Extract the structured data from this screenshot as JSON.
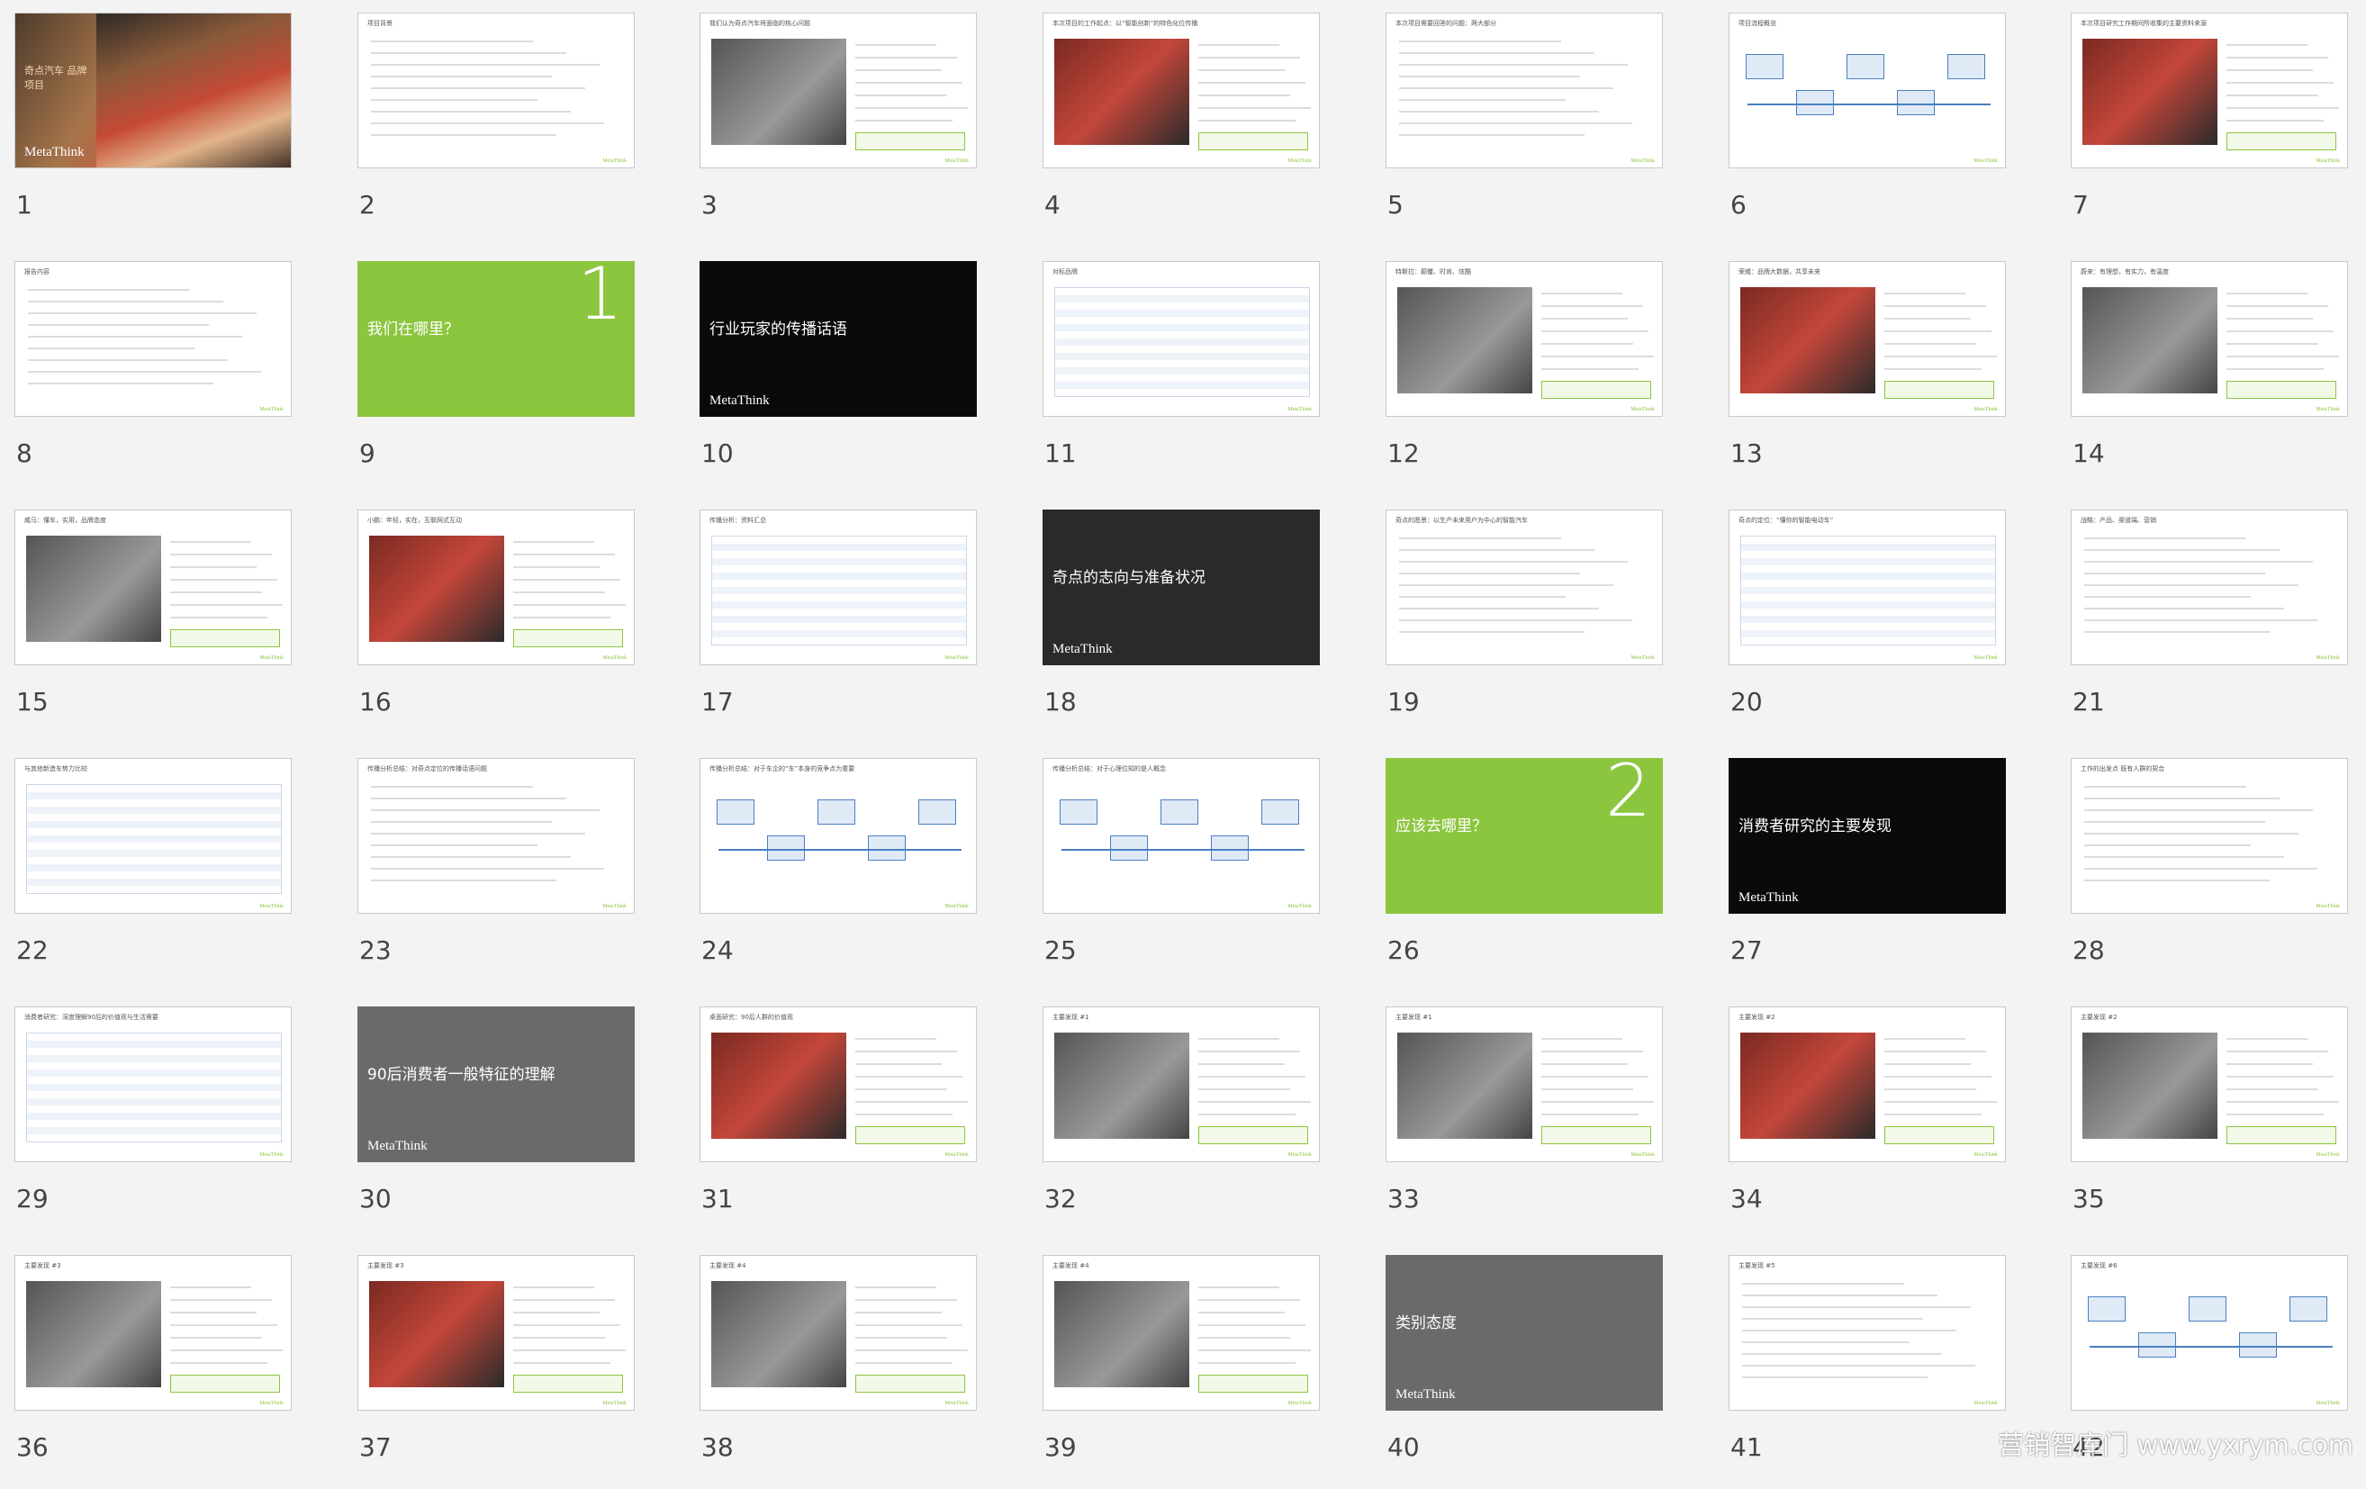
{
  "slides": [
    {
      "n": "1",
      "kind": "photo",
      "label": "",
      "logo": "MetaThink",
      "caption": "奇点汽车 品牌项目"
    },
    {
      "n": "2",
      "kind": "text",
      "title": "项目背景"
    },
    {
      "n": "3",
      "kind": "mixed",
      "title": "我们认为奇点汽车将面临的核心问题"
    },
    {
      "n": "4",
      "kind": "mixed",
      "title": "本次项目的工作起点：以“智能创新”的特色化位传播"
    },
    {
      "n": "5",
      "kind": "text",
      "title": "本次项目需要回答的问题：两大部分"
    },
    {
      "n": "6",
      "kind": "diagram",
      "title": "项目流程概览"
    },
    {
      "n": "7",
      "kind": "mixed",
      "title": "本次项目研究工作期间所收集的主要资料来源"
    },
    {
      "n": "8",
      "kind": "text",
      "title": "报告内容"
    },
    {
      "n": "9",
      "kind": "green",
      "label": "我们在哪里？",
      "big": "1"
    },
    {
      "n": "10",
      "kind": "black",
      "label": "行业玩家的传播话语",
      "logo": "MetaThink"
    },
    {
      "n": "11",
      "kind": "table",
      "title": "对标品牌"
    },
    {
      "n": "12",
      "kind": "mixed",
      "title": "特斯拉：颠覆、时尚、炫酷"
    },
    {
      "n": "13",
      "kind": "mixed",
      "title": "荣威：品牌大数据，共享未来"
    },
    {
      "n": "14",
      "kind": "mixed",
      "title": "蔚来：有理想，有实力，有温度"
    },
    {
      "n": "15",
      "kind": "mixed",
      "title": "威马：懂车，实用，品牌态度"
    },
    {
      "n": "16",
      "kind": "mixed",
      "title": "小鹏：年轻，实在，互联网式互动"
    },
    {
      "n": "17",
      "kind": "table",
      "title": "传播分析：资料汇总"
    },
    {
      "n": "18",
      "kind": "dark",
      "label": "奇点的志向与准备状况",
      "logo": "MetaThink"
    },
    {
      "n": "19",
      "kind": "text",
      "title": "奇点的愿景：以生产未来用户为中心的智能汽车"
    },
    {
      "n": "20",
      "kind": "table",
      "title": "奇点的定位：“懂你的智能电动车”"
    },
    {
      "n": "21",
      "kind": "text",
      "title": "战略：产品、渠道端、营销"
    },
    {
      "n": "22",
      "kind": "table",
      "title": "与其他新造车势力比较"
    },
    {
      "n": "23",
      "kind": "text",
      "title": "传播分析总结：对奇点定位的传播话语问题"
    },
    {
      "n": "24",
      "kind": "diagram",
      "title": "传播分析总结：对于车企的“车”本身的竞争点为重要"
    },
    {
      "n": "25",
      "kind": "diagram",
      "title": "传播分析总结：对于心理位知的是人概念"
    },
    {
      "n": "26",
      "kind": "green",
      "label": "应该去哪里？",
      "big": "2"
    },
    {
      "n": "27",
      "kind": "black",
      "label": "消费者研究的主要发现",
      "logo": "MetaThink"
    },
    {
      "n": "28",
      "kind": "text",
      "title": "工作的出发点 既有人群的契合"
    },
    {
      "n": "29",
      "kind": "table",
      "title": "消费者研究：深度理解90后的价值观与生活需要"
    },
    {
      "n": "30",
      "kind": "gray",
      "label": "90后消费者一般特征的理解",
      "logo": "MetaThink"
    },
    {
      "n": "31",
      "kind": "mixed",
      "title": "桌面研究：90后人群的价值观"
    },
    {
      "n": "32",
      "kind": "mixed",
      "title": "主要发现 #1"
    },
    {
      "n": "33",
      "kind": "mixed",
      "title": "主要发现 #1"
    },
    {
      "n": "34",
      "kind": "mixed",
      "title": "主要发现 #2"
    },
    {
      "n": "35",
      "kind": "mixed",
      "title": "主要发现 #2"
    },
    {
      "n": "36",
      "kind": "mixed",
      "title": "主要发现 #3"
    },
    {
      "n": "37",
      "kind": "mixed",
      "title": "主要发现 #3"
    },
    {
      "n": "38",
      "kind": "mixed",
      "title": "主要发现 #4"
    },
    {
      "n": "39",
      "kind": "mixed",
      "title": "主要发现 #4"
    },
    {
      "n": "40",
      "kind": "gray",
      "label": "类别态度",
      "logo": "MetaThink"
    },
    {
      "n": "41",
      "kind": "text",
      "title": "主要发现 #5"
    },
    {
      "n": "42",
      "kind": "diagram",
      "title": "主要发现 #6"
    }
  ],
  "watermark": "营销智库门 www.yxrym.com",
  "colors": {
    "green": "#8cc63f",
    "black": "#0a0a0a",
    "gray": "#6b6a68",
    "dark": "#2a2a2a"
  }
}
